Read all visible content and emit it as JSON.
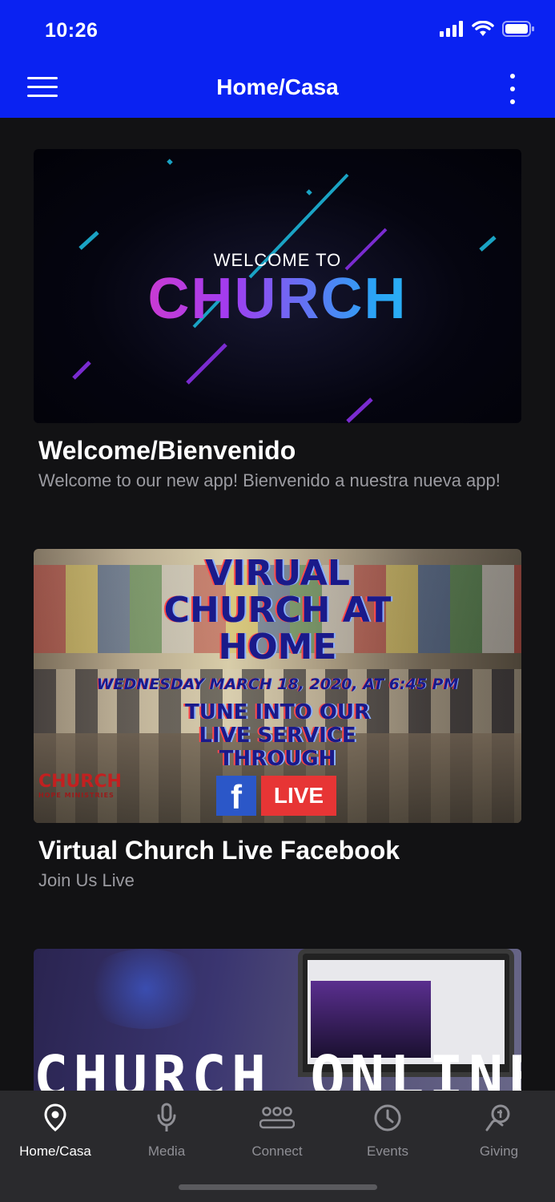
{
  "status_bar": {
    "time": "10:26",
    "icons": [
      "signal-icon",
      "wifi-icon",
      "battery-icon"
    ]
  },
  "app_bar": {
    "title": "Home/Casa",
    "left_icon": "hamburger-menu-icon",
    "right_icon": "more-vertical-icon",
    "color": "#0a22f2"
  },
  "feed": {
    "items": [
      {
        "title": "Welcome/Bienvenido",
        "subtitle": "Welcome to our new app! Bienvenido a nuestra nueva app!",
        "image_text": {
          "line1": "WELCOME TO",
          "line2": "CHURCH"
        }
      },
      {
        "title": "Virtual Church Live Facebook",
        "subtitle": "Join Us Live",
        "image_text": {
          "headline": "VIRUAL CHURCH AT HOME",
          "date": "WEDNESDAY MARCH 18, 2020, AT 6:45 PM",
          "tune": "TUNE INTO OUR LIVE SERVICE THROUGH",
          "logo": "CHURCH",
          "logo_sub": "HOPE MINISTRIES",
          "fb": "f",
          "live": "LIVE"
        }
      },
      {
        "image_text": {
          "headline": "CHURCH ONLINE"
        }
      }
    ]
  },
  "tab_bar": {
    "tabs": [
      {
        "label": "Home/Casa",
        "icon": "location-pin-icon",
        "active": true
      },
      {
        "label": "Media",
        "icon": "microphone-icon",
        "active": false
      },
      {
        "label": "Connect",
        "icon": "people-group-icon",
        "active": false
      },
      {
        "label": "Events",
        "icon": "clock-icon",
        "active": false
      },
      {
        "label": "Giving",
        "icon": "giving-hand-icon",
        "active": false
      }
    ]
  }
}
